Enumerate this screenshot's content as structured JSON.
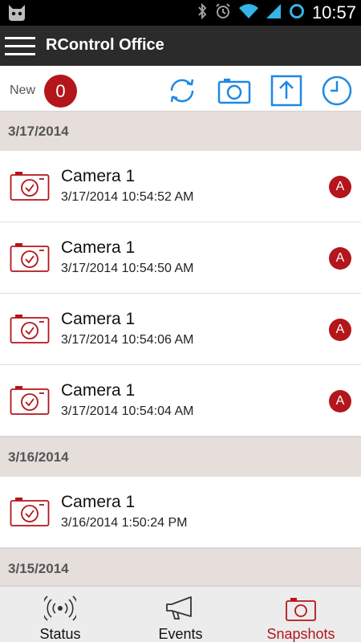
{
  "status_bar": {
    "time": "10:57",
    "icons": [
      "android-cat-icon",
      "bluetooth-icon",
      "alarm-icon",
      "wifi-icon",
      "signal-icon",
      "sync-ring-icon"
    ]
  },
  "action_bar": {
    "title": "RControl Office",
    "menu_icon": "hamburger-icon"
  },
  "toolbar": {
    "new_label": "New",
    "new_count": "0",
    "buttons": [
      {
        "icon": "refresh-icon"
      },
      {
        "icon": "camera-icon"
      },
      {
        "icon": "upload-icon"
      },
      {
        "icon": "clock-icon"
      }
    ]
  },
  "sections": [
    {
      "date": "3/17/2014",
      "items": [
        {
          "title": "Camera 1",
          "timestamp": "3/17/2014 10:54:52 AM",
          "badge": "A"
        },
        {
          "title": "Camera 1",
          "timestamp": "3/17/2014 10:54:50 AM",
          "badge": "A"
        },
        {
          "title": "Camera 1",
          "timestamp": "3/17/2014 10:54:06 AM",
          "badge": "A"
        },
        {
          "title": "Camera 1",
          "timestamp": "3/17/2014 10:54:04 AM",
          "badge": "A"
        }
      ]
    },
    {
      "date": "3/16/2014",
      "items": [
        {
          "title": "Camera 1",
          "timestamp": "3/16/2014 1:50:24 PM",
          "badge": ""
        }
      ]
    },
    {
      "date": "3/15/2014",
      "items": []
    }
  ],
  "bottom_nav": {
    "tabs": [
      {
        "label": "Status",
        "icon": "antenna-icon",
        "active": false
      },
      {
        "label": "Events",
        "icon": "megaphone-icon",
        "active": false
      },
      {
        "label": "Snapshots",
        "icon": "camera-icon",
        "active": true
      }
    ]
  },
  "colors": {
    "accent": "#b3161b",
    "toolbar_icon": "#1e88e5",
    "action_bar": "#2b2b2b",
    "section_header": "#e5dedb"
  }
}
